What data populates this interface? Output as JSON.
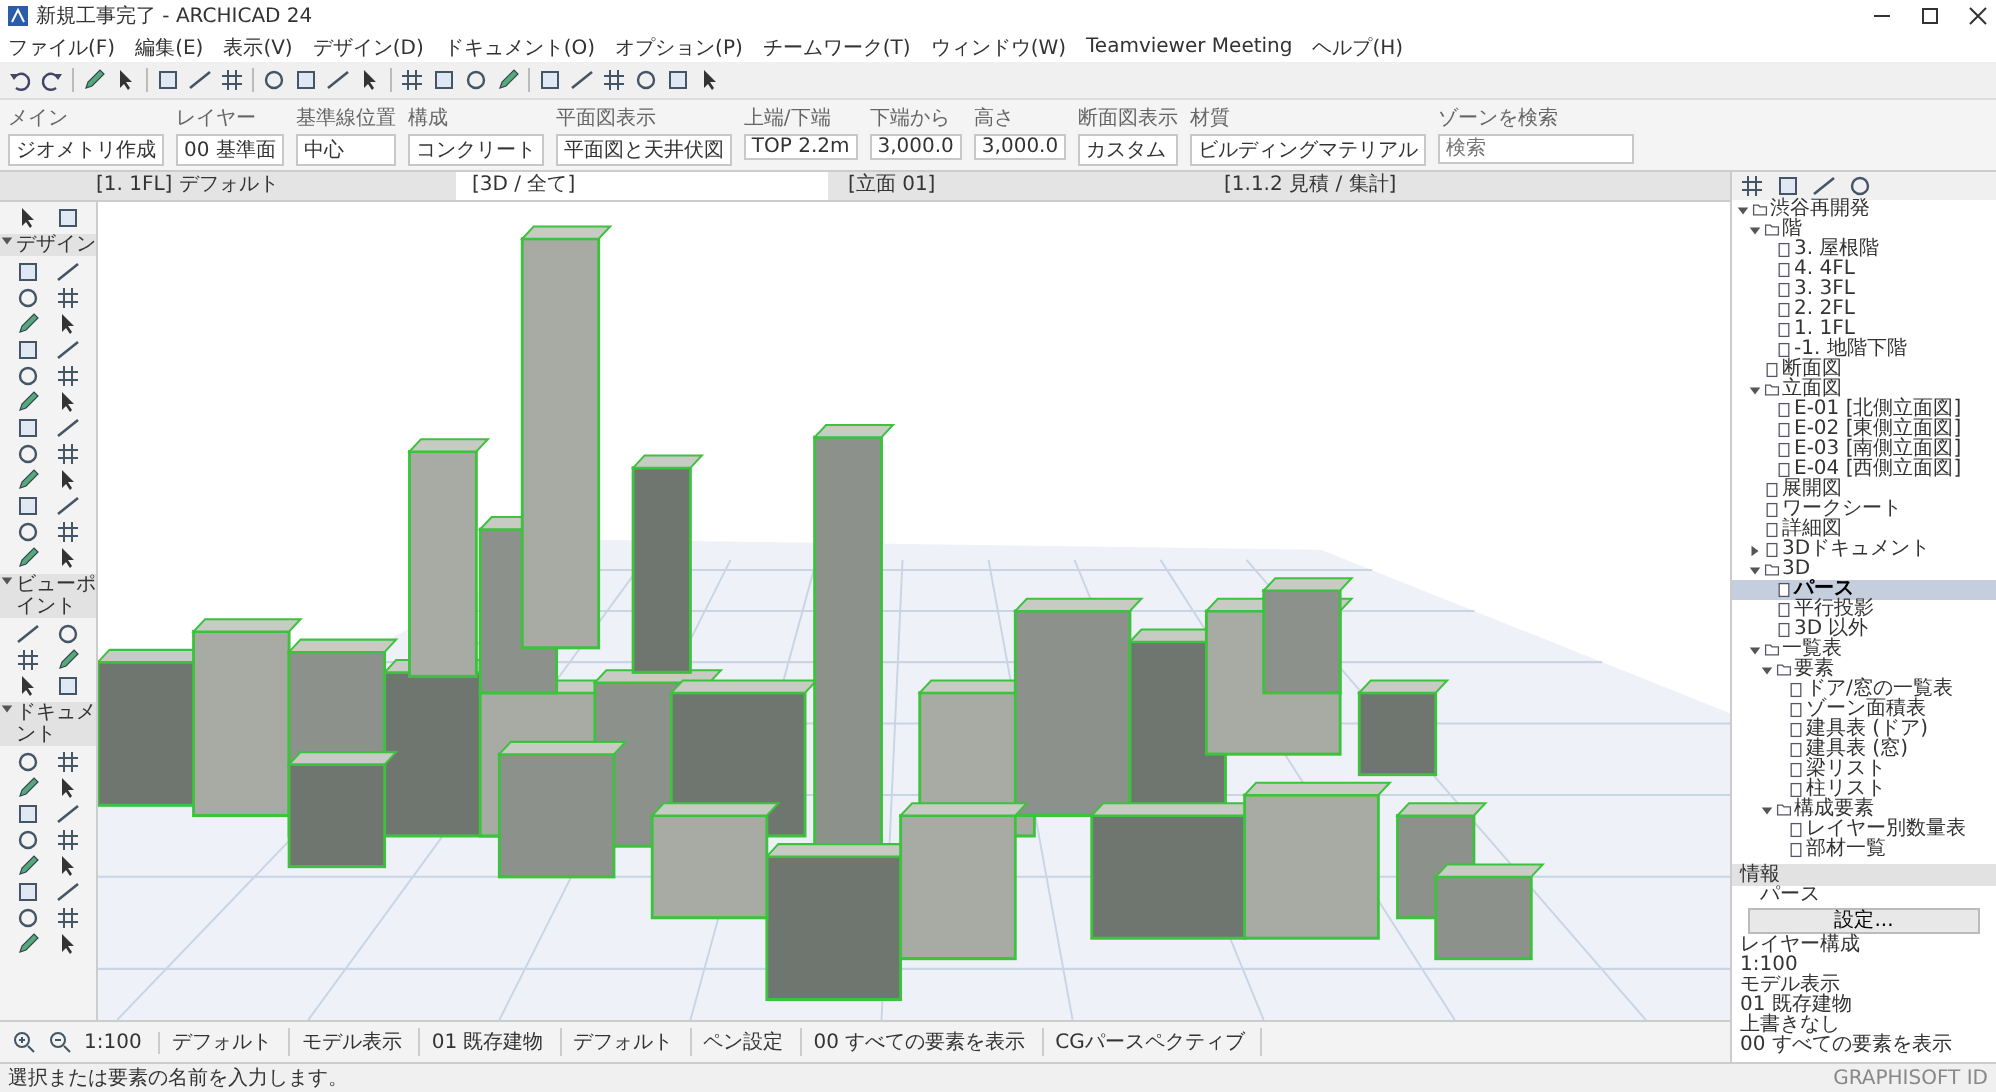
{
  "window": {
    "title": "新規工事完了 - ARCHICAD 24"
  },
  "menu": [
    "ファイル(F)",
    "編集(E)",
    "表示(V)",
    "デザイン(D)",
    "ドキュメント(O)",
    "オプション(P)",
    "チームワーク(T)",
    "ウィンドウ(W)",
    "Teamviewer Meeting",
    "ヘルプ(H)"
  ],
  "info_box": {
    "sections": [
      {
        "label": "メイン",
        "value": "ジオメトリ作成"
      },
      {
        "label": "レイヤー",
        "value": "00 基準面"
      },
      {
        "label": "基準線位置",
        "value": "中心"
      },
      {
        "label": "構成",
        "value": "コンクリート"
      },
      {
        "label": "平面図表示",
        "value": "平面図と天井伏図"
      },
      {
        "label": "上端/下端",
        "value": "TOP 2.2m"
      },
      {
        "label": "下端から",
        "value": "3,000.0"
      },
      {
        "label": "高さ",
        "value": "3,000.0"
      },
      {
        "label": "断面図表示",
        "value": "カスタム"
      },
      {
        "label": "材質",
        "value": "ビルディングマテリアル"
      }
    ],
    "search": {
      "label": "ゾーンを検索",
      "placeholder": "検索"
    }
  },
  "view_tabs": [
    {
      "label": "[1. 1FL] デフォルト",
      "selected": false
    },
    {
      "label": "[3D / 全て]",
      "selected": true
    },
    {
      "label": "[立面 01]",
      "selected": false
    },
    {
      "label": "[1.1.2 見積 / 集計]",
      "selected": false
    }
  ],
  "toolbox": {
    "groups": [
      {
        "label": "デザイン",
        "expanded": true
      },
      {
        "label": "ビューポイント",
        "expanded": true
      },
      {
        "label": "ドキュメント",
        "expanded": true
      }
    ]
  },
  "navigator": {
    "tree": [
      {
        "label": "渋谷再開発",
        "selected": false,
        "expanded": true,
        "children": [
          {
            "label": "階",
            "selected": false,
            "expanded": true,
            "children": [
              {
                "label": "3. 屋根階",
                "selected": false
              },
              {
                "label": "4. 4FL",
                "selected": false
              },
              {
                "label": "3. 3FL",
                "selected": false
              },
              {
                "label": "2. 2FL",
                "selected": false
              },
              {
                "label": "1. 1FL",
                "selected": false
              },
              {
                "label": "-1. 地階下階",
                "selected": false
              }
            ]
          },
          {
            "label": "断面図",
            "selected": false
          },
          {
            "label": "立面図",
            "selected": false,
            "expanded": true,
            "children": [
              {
                "label": "E-01 [北側立面図]",
                "selected": false
              },
              {
                "label": "E-02 [東側立面図]",
                "selected": false
              },
              {
                "label": "E-03 [南側立面図]",
                "selected": false
              },
              {
                "label": "E-04 [西側立面図]",
                "selected": false
              }
            ]
          },
          {
            "label": "展開図",
            "selected": false
          },
          {
            "label": "ワークシート",
            "selected": false
          },
          {
            "label": "詳細図",
            "selected": false
          },
          {
            "label": "3Dドキュメント",
            "selected": false,
            "expanded": false
          },
          {
            "label": "3D",
            "selected": false,
            "expanded": true,
            "children": [
              {
                "label": "パース",
                "selected": true
              },
              {
                "label": "平行投影",
                "selected": false
              },
              {
                "label": "3D 以外",
                "selected": false
              }
            ]
          },
          {
            "label": "一覧表",
            "selected": false,
            "expanded": true,
            "children": [
              {
                "label": "要素",
                "selected": false,
                "expanded": true,
                "children": [
                  {
                    "label": "ドア/窓の一覧表",
                    "selected": false
                  },
                  {
                    "label": "ゾーン面積表",
                    "selected": false
                  },
                  {
                    "label": "建具表 (ドア)",
                    "selected": false
                  },
                  {
                    "label": "建具表 (窓)",
                    "selected": false
                  },
                  {
                    "label": "梁リスト",
                    "selected": false
                  },
                  {
                    "label": "柱リスト",
                    "selected": false
                  }
                ]
              },
              {
                "label": "構成要素",
                "selected": false,
                "expanded": true,
                "children": [
                  {
                    "label": "レイヤー別数量表",
                    "selected": false
                  },
                  {
                    "label": "部材一覧",
                    "selected": false
                  }
                ]
              }
            ]
          }
        ]
      }
    ]
  },
  "info_panel": {
    "title": "情報",
    "view_name": "パース",
    "settings_button": "設定...",
    "items": [
      "レイヤー構成",
      "1:100",
      "モデル表示",
      "01 既存建物",
      "上書きなし",
      "00 すべての要素を表示"
    ]
  },
  "view_bar": {
    "items": [
      "1:100",
      "デフォルト",
      "モデル表示",
      "01 既存建物",
      "デフォルト",
      "ペン設定",
      "00 すべての要素を表示",
      "CGパースペクティブ"
    ]
  },
  "status_bar": {
    "message": "選択または要素の名前を入力します。",
    "brand": "GRAPHISOFT ID"
  }
}
